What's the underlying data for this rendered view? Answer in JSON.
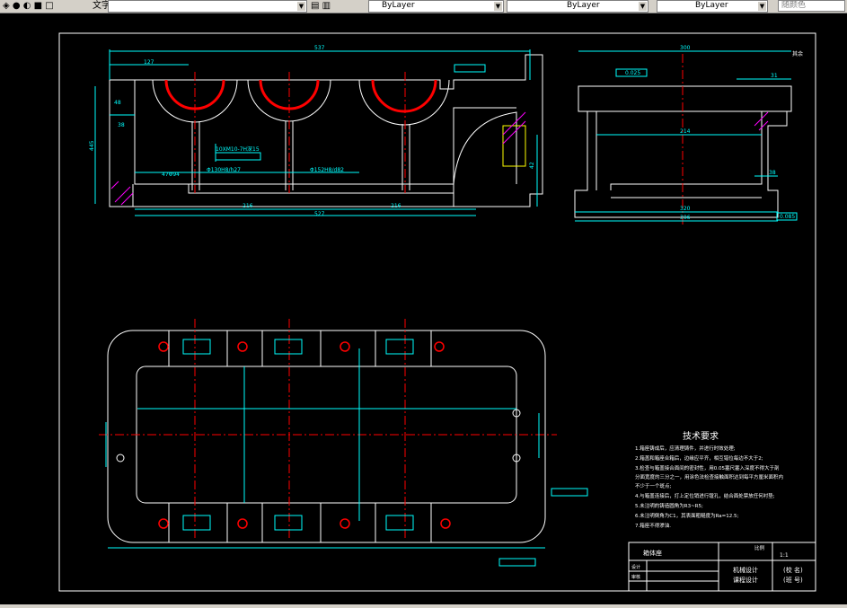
{
  "toolbar": {
    "text_style_label": "文字",
    "layer_combo": "ByLayer",
    "linetype_combo": "ByLayer",
    "lineweight_combo": "ByLayer",
    "color_button": "随颜色"
  },
  "drawing": {
    "dims_front": {
      "overall": "537",
      "d127": "127",
      "d48": "48",
      "d38": "38",
      "d445": "445",
      "d216a": "216",
      "d216b": "216",
      "d527": "527",
      "d42": "42",
      "bore1": "Φ130H8/h27",
      "bore2": "Φ152H8/d82",
      "small1": "47Φ94",
      "hole_callout": "10XM10-7H深15"
    },
    "dims_side": {
      "d300": "300",
      "d214": "214",
      "d31": "31",
      "d38": "38",
      "d320": "320",
      "d306": "306",
      "tol1": "0.025",
      "tol2": "0.085",
      "surface": "其余"
    },
    "tech": {
      "title": "技术要求",
      "items": [
        "1.箱座铸成后，应清理铸件，并进行时效处理;",
        "2.箱盖和箱座合箱后，边缘应平齐，相互错位每边不大于2;",
        "3.检查与箱盖接合面间的密封性，用0.05塞尺塞入深度不得大于剖",
        "分面宽度的三分之一，用涂色法检查接触面积达到每平方厘米面积内",
        "不少于一个斑点;",
        "4.与箱盖连接后，打上定位销进行镗孔，结合面处禁放任何衬垫;",
        "5.未注明的铸造圆角为R3~R5;",
        "6.未注明倒角为C1，其表面粗糙度为Ra=12.5;",
        "7.箱座不得渗油."
      ]
    },
    "titleblock": {
      "part_name": "箱体座",
      "scale_label": "比例",
      "ratio": "1:1",
      "designer": "设计",
      "checker": "审核",
      "course": "机械设计",
      "project": "课程设计",
      "school": "(校 名)",
      "class": "(班 号)"
    }
  }
}
